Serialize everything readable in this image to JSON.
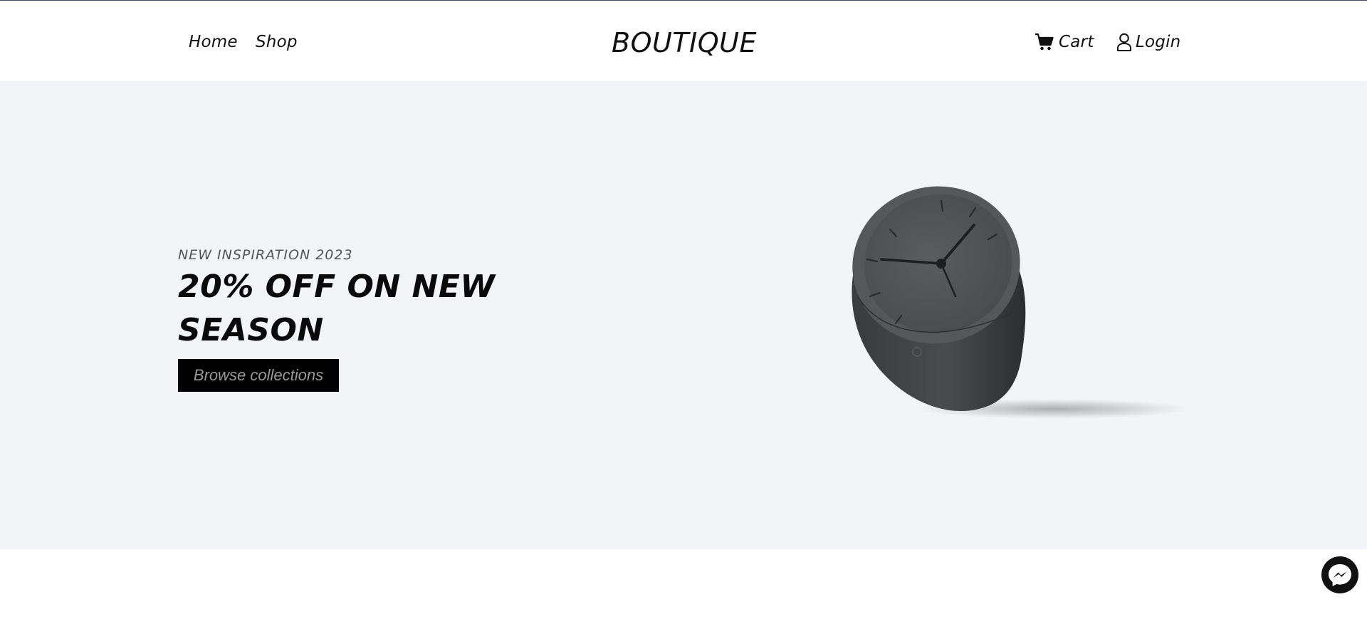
{
  "nav": {
    "home_label": "Home",
    "shop_label": "Shop",
    "brand": "BOUTIQUE",
    "cart_label": "Cart",
    "login_label": "Login",
    "cart_icon": "cart-icon",
    "login_icon": "user-icon"
  },
  "hero": {
    "eyebrow": "NEW INSPIRATION 2023",
    "title": "20% OFF ON NEW SEASON",
    "button_label": "Browse collections",
    "image": "desk-clock-product-photo"
  },
  "chat": {
    "icon": "messenger-icon"
  },
  "colors": {
    "hero_background": "#f3f4f7",
    "button_background": "#000000",
    "button_text": "#9a9a9a",
    "text_primary": "#111111"
  }
}
